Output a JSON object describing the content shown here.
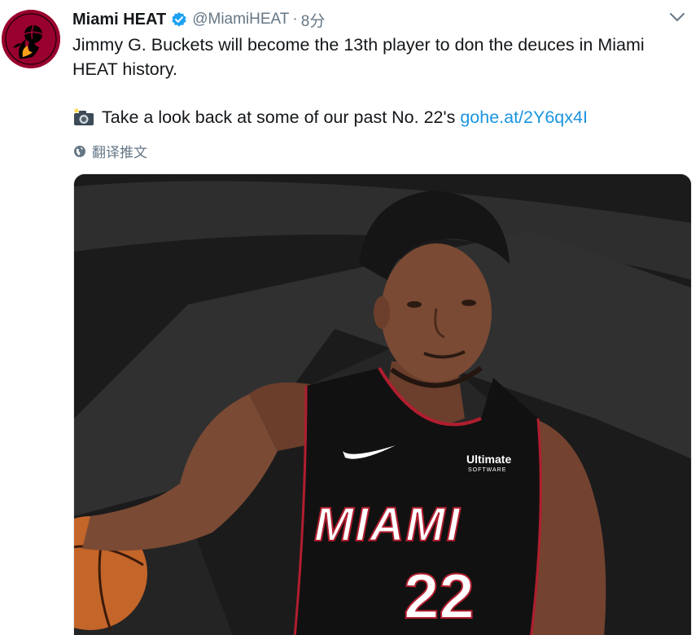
{
  "tweet": {
    "display_name": "Miami HEAT",
    "handle": "@MiamiHEAT",
    "separator": "·",
    "timestamp": "8分",
    "text_line1": "Jimmy G. Buckets will become the 13th player to don the deuces in Miami HEAT history.",
    "text_line2": "Take a look back at some of our past No. 22's",
    "link": "gohe.at/2Y6qx4I",
    "translate_label": "翻译推文",
    "icons": [
      "avatar-logo",
      "verified-badge-icon",
      "chevron-down-icon",
      "camera-flash-icon",
      "globe-icon"
    ]
  },
  "media": {
    "jersey_brand": "MIAMI",
    "jersey_number": "22",
    "sponsor_line1": "Ultimate",
    "sponsor_line2": "SOFTWARE"
  },
  "colors": {
    "link": "#1b95e0",
    "meta": "#657786",
    "heat_red": "#98002e",
    "verified": "#1da1f2"
  }
}
